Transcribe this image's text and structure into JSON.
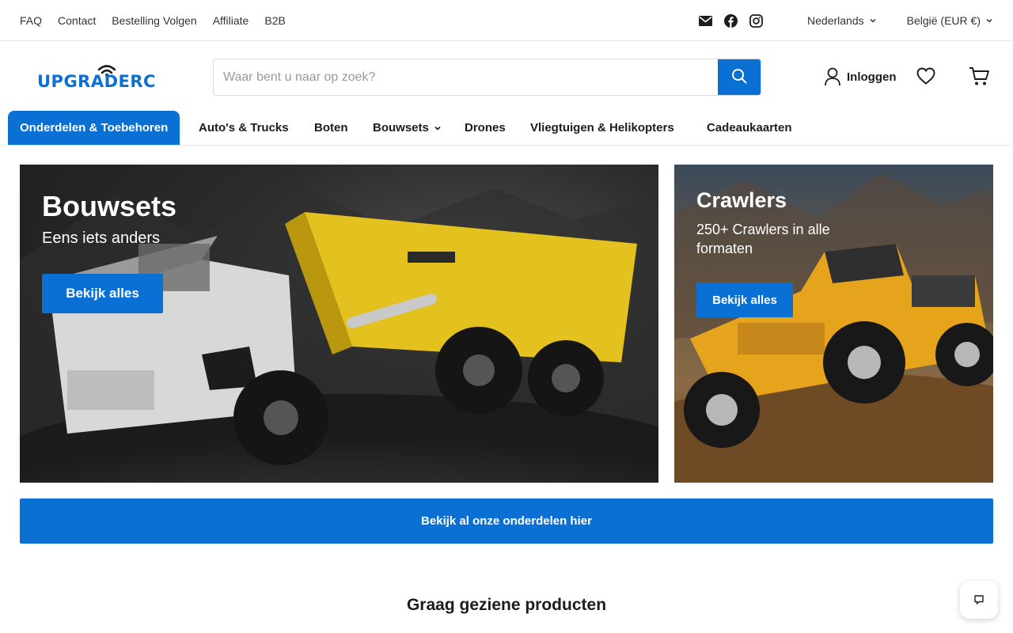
{
  "utility": {
    "links": [
      "FAQ",
      "Contact",
      "Bestelling Volgen",
      "Affiliate",
      "B2B"
    ],
    "language": "Nederlands",
    "currency": "België (EUR €)"
  },
  "header": {
    "logo_text": "UPGRADERC",
    "search_placeholder": "Waar bent u naar op zoek?",
    "account_label": "Inloggen"
  },
  "nav": {
    "items": [
      "Onderdelen & Toebehoren",
      "Auto's & Trucks",
      "Boten",
      "Bouwsets",
      "Drones",
      "Vliegtuigen & Helikopters",
      "Cadeaukaarten"
    ]
  },
  "hero": {
    "left": {
      "title": "Bouwsets",
      "subtitle": "Eens iets anders",
      "button": "Bekijk alles"
    },
    "right": {
      "title": "Crawlers",
      "subtitle": "250+ Crawlers in alle formaten",
      "button": "Bekijk alles"
    }
  },
  "cta_label": "Bekijk al onze onderdelen hier",
  "section_title": "Graag geziene producten",
  "colors": {
    "accent": "#0a70d4"
  },
  "icons": [
    "email-icon",
    "facebook-icon",
    "instagram-icon",
    "search-icon",
    "user-icon",
    "heart-icon",
    "cart-icon",
    "chat-icon"
  ]
}
